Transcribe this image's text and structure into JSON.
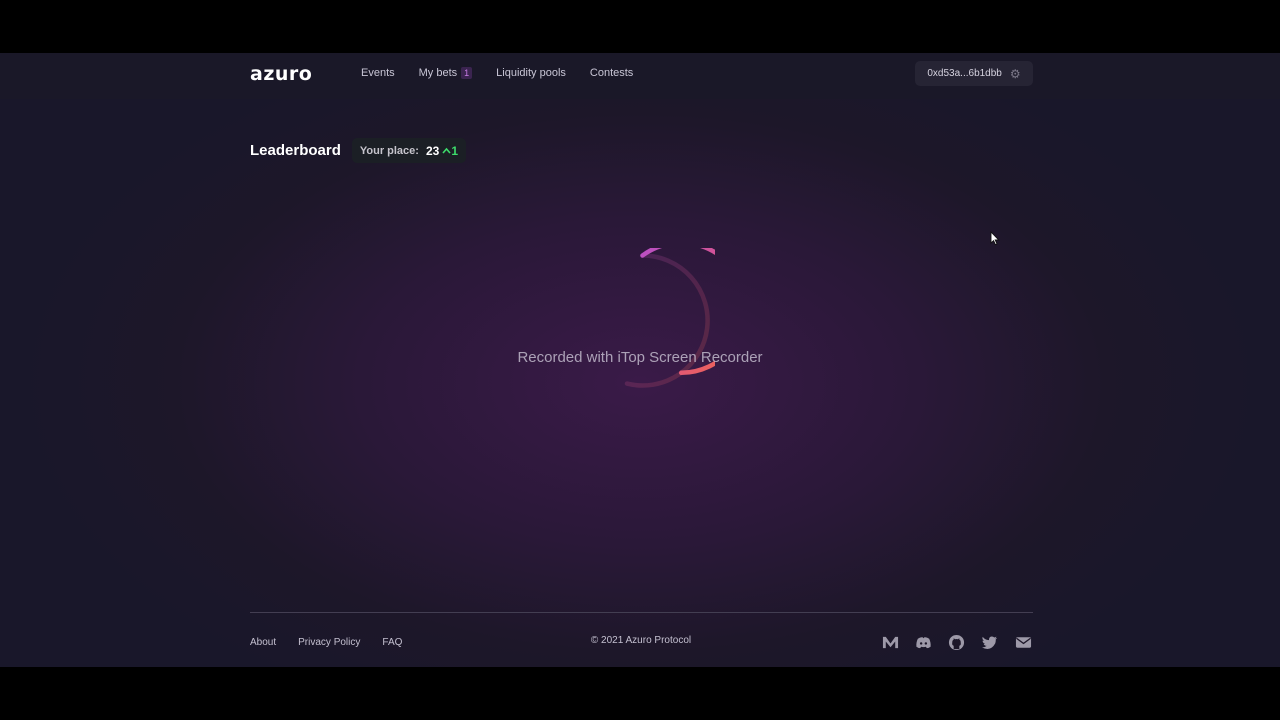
{
  "brand": {
    "logo": "azuro"
  },
  "nav": {
    "events": "Events",
    "my_bets": "My bets",
    "my_bets_count": "1",
    "liquidity_pools": "Liquidity pools",
    "contests": "Contests"
  },
  "wallet": {
    "address": "0xd53a...6b1dbb",
    "icon": "gear-icon"
  },
  "leaderboard": {
    "title": "Leaderboard",
    "place_label": "Your place:",
    "place_value": "23",
    "place_change": "1",
    "change_color": "#3ddc6b"
  },
  "overlay": {
    "watermark": "Recorded with iTop Screen Recorder"
  },
  "footer": {
    "about": "About",
    "privacy": "Privacy Policy",
    "faq": "FAQ",
    "copyright": "© 2021 Azuro Protocol",
    "socials": [
      "medium-icon",
      "discord-icon",
      "github-icon",
      "twitter-icon",
      "mail-icon"
    ]
  },
  "colors": {
    "accent_pink": "#c15ac8",
    "accent_orange": "#f0604a",
    "background": "#1d1729"
  }
}
